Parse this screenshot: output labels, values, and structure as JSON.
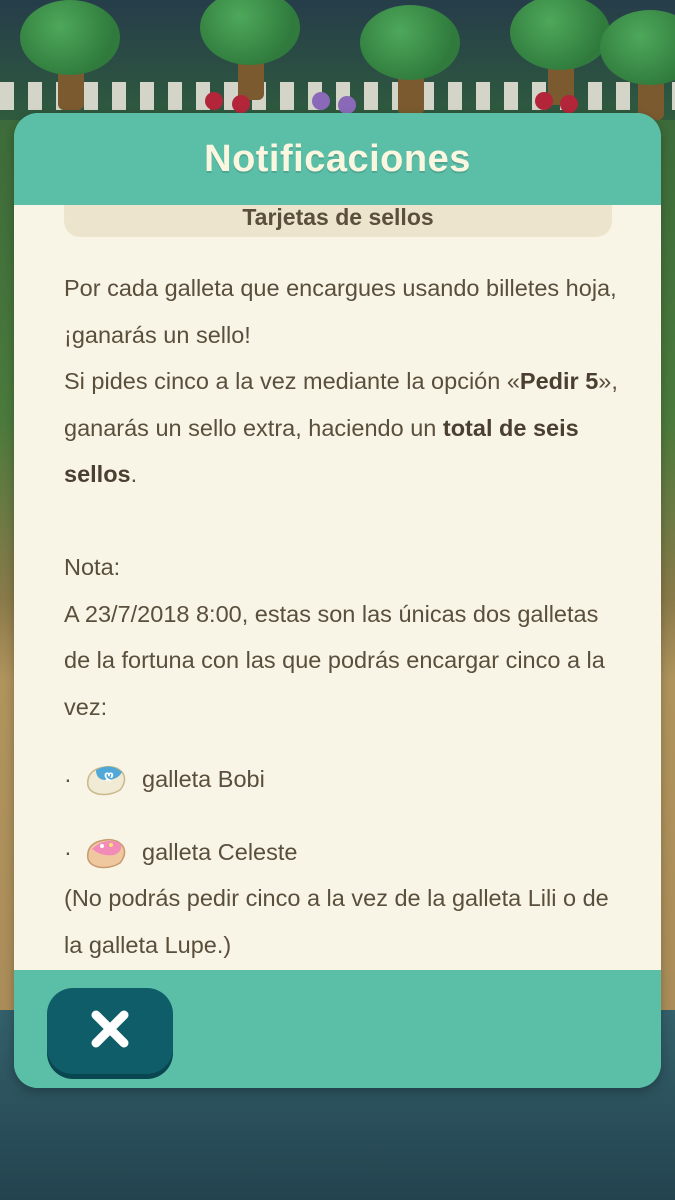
{
  "dialog": {
    "title": "Notificaciones",
    "section_title": "Tarjetas de sellos",
    "paragraph1": {
      "line1": "Por cada galleta que encargues usando billetes hoja, ¡ganarás un sello!",
      "line2_prefix": "Si pides cinco a la vez mediante la opción «",
      "line2_bold": "Pedir 5",
      "line2_mid": "», ganarás un sello extra, haciendo un ",
      "line2_bold2": "total de seis sellos",
      "line2_suffix": "."
    },
    "note_label": "Nota:",
    "note_text": "A 23/7/2018 8:00, estas son las únicas dos galletas de la fortuna con las que podrás encargar cinco a la vez:",
    "cookies": [
      {
        "bullet": "·",
        "icon": "blue-fortune-cookie-icon",
        "label": "galleta Bobi"
      },
      {
        "bullet": "·",
        "icon": "pink-fortune-cookie-icon",
        "label": "galleta Celeste"
      }
    ],
    "footnote": "(No podrás pedir cinco a la vez de la galleta Lili o de la galleta Lupe.)",
    "close_icon": "close-x-icon"
  },
  "colors": {
    "accent": "#5bbfa8",
    "panel": "#f8f5e6",
    "text": "#5a4e3c",
    "close_button": "#0f5d68"
  }
}
